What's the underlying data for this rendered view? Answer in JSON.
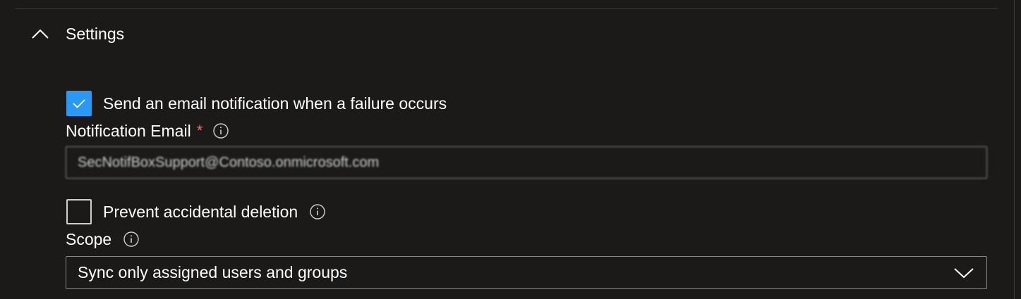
{
  "settings_section": {
    "title": "Settings",
    "expanded": true,
    "toggle_icon": "chevron-up-icon"
  },
  "email_notification": {
    "checkbox_label": "Send an email notification when a failure occurs",
    "checked": true
  },
  "notification_email": {
    "label": "Notification Email",
    "required_marker": "*",
    "info_icon": "info-icon",
    "value": "SecNotifBoxSupport@Contoso.onmicrosoft.com",
    "blurred": true
  },
  "prevent_deletion": {
    "checkbox_label": "Prevent accidental deletion",
    "checked": false,
    "info_icon": "info-icon"
  },
  "scope": {
    "label": "Scope",
    "info_icon": "info-icon",
    "selected": "Sync only assigned users and groups",
    "dropdown_icon": "chevron-down-icon"
  },
  "colors": {
    "background": "#1b1a19",
    "checkbox_checked": "#2899f5",
    "required": "#f1707b",
    "input_border": "#8a8886"
  }
}
